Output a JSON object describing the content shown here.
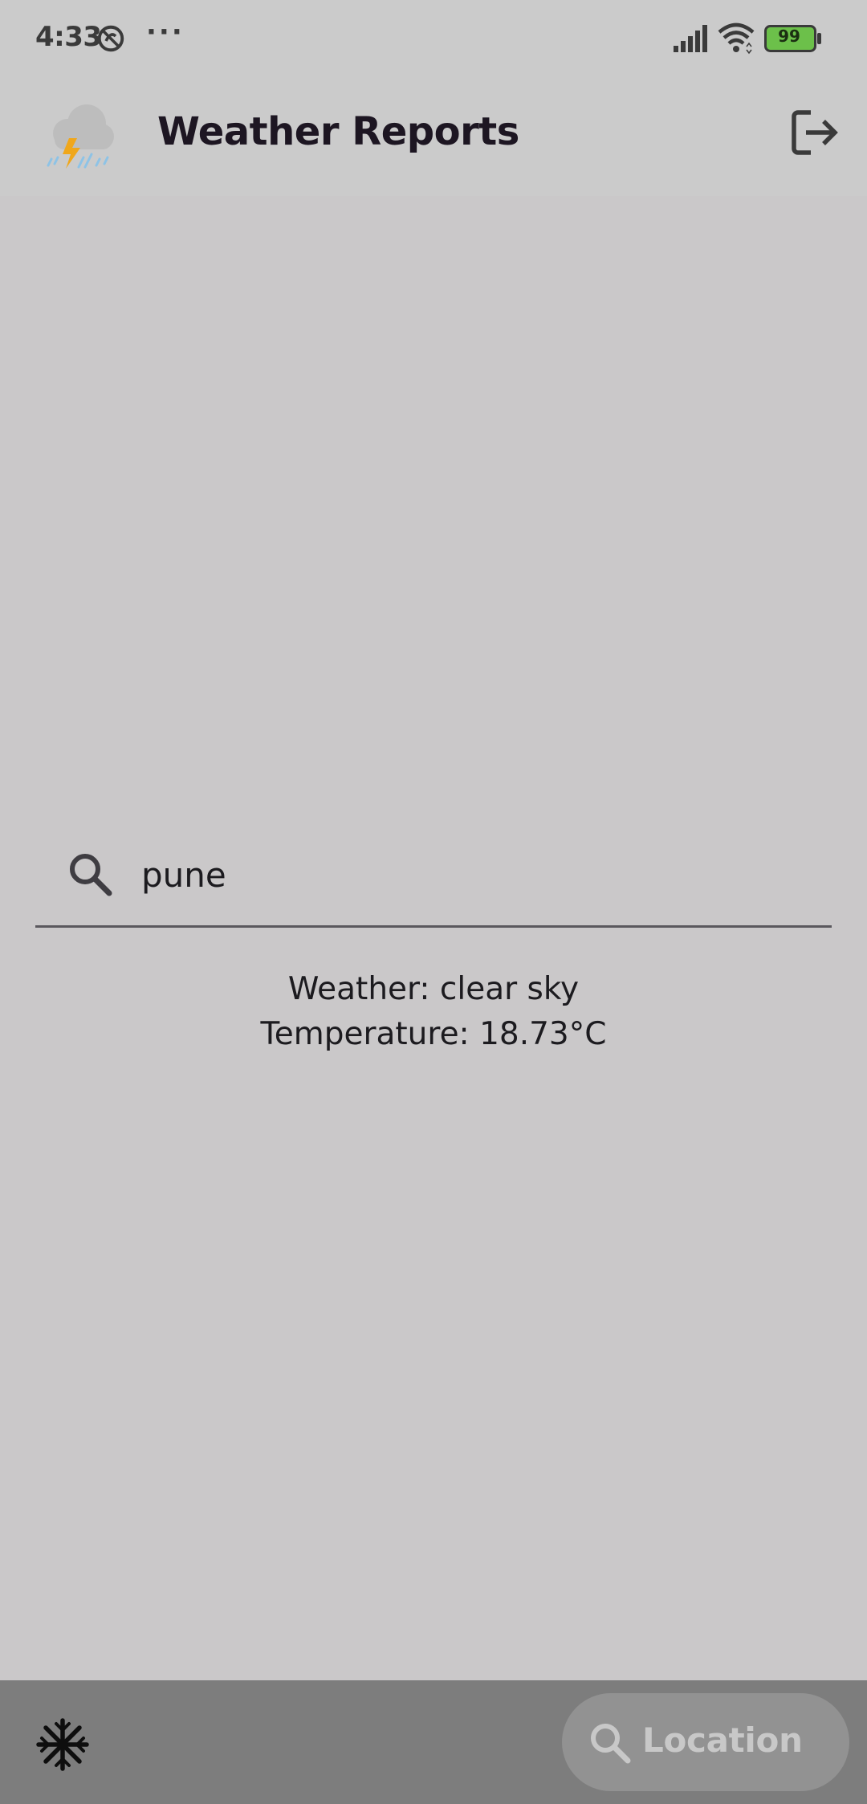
{
  "status_bar": {
    "time": "4:33",
    "more": "···",
    "battery_level": "99",
    "icons": [
      "do-not-disturb-icon",
      "signal-icon",
      "wifi-icon",
      "battery-icon"
    ]
  },
  "app_bar": {
    "title": "Weather Reports",
    "logo_icon": "thunderstorm-rain-icon",
    "logout_icon": "logout-icon"
  },
  "search": {
    "value": "pune",
    "icon": "search-icon"
  },
  "result": {
    "weather": "Weather: clear sky",
    "temperature": "Temperature: 18.73°C"
  },
  "bottom_bar": {
    "left_icon": "snowflake-icon",
    "fab_label": "Location",
    "fab_icon": "search-icon"
  },
  "colors": {
    "background": "#cac8c9",
    "bottom_bar": "#7d7d7d",
    "fab": "#929292",
    "battery": "#6cc04a",
    "bolt": "#f0a71b",
    "rain": "#8ec3e6"
  }
}
